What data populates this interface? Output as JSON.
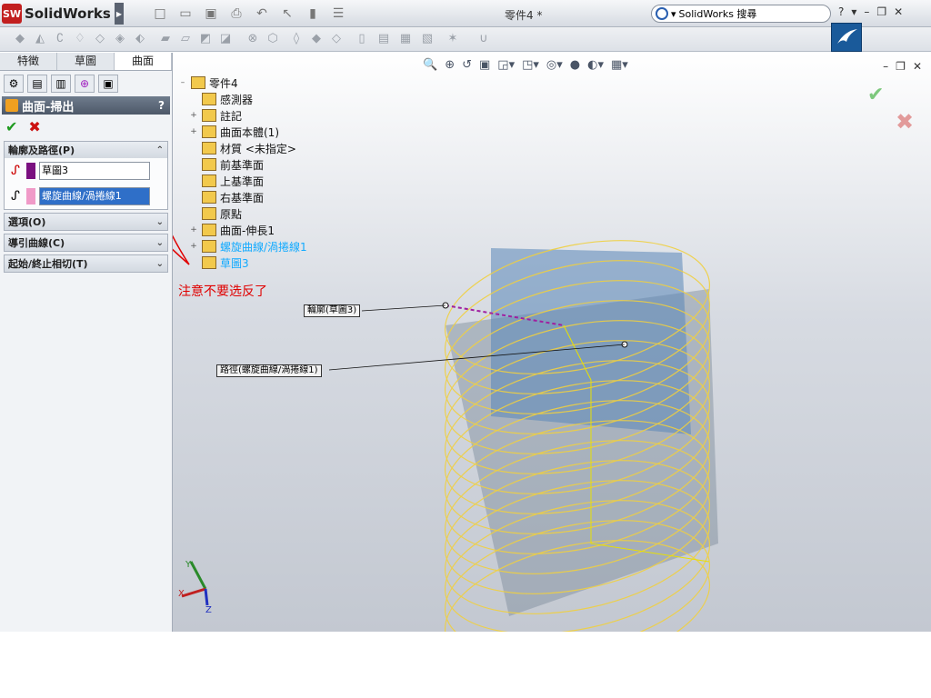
{
  "app": {
    "logo_text": "SolidWorks",
    "doc_title": "零件4 *",
    "search_placeholder": "SolidWorks 搜尋",
    "help_label": "?"
  },
  "left_panel": {
    "tabs": [
      "特徵",
      "草圖",
      "曲面"
    ],
    "active_tab": "曲面",
    "pm_title": "曲面-掃出",
    "help": "?",
    "groups": [
      {
        "title": "輪廓及路徑(P)",
        "expanded": true
      },
      {
        "title": "選項(O)",
        "expanded": false
      },
      {
        "title": "導引曲線(C)",
        "expanded": false
      },
      {
        "title": "起始/終止相切(T)",
        "expanded": false
      }
    ],
    "profile_value": "草圖3",
    "path_value": "螺旋曲線/渦捲線1"
  },
  "tree": {
    "root": "零件4",
    "items": [
      {
        "label": "感測器",
        "expandable": false
      },
      {
        "label": "註記",
        "expandable": true
      },
      {
        "label": "曲面本體(1)",
        "expandable": true
      },
      {
        "label": "材質 <未指定>",
        "expandable": false
      },
      {
        "label": "前基準面",
        "expandable": false
      },
      {
        "label": "上基準面",
        "expandable": false
      },
      {
        "label": "右基準面",
        "expandable": false
      },
      {
        "label": "原點",
        "expandable": false
      },
      {
        "label": "曲面-伸長1",
        "expandable": true
      },
      {
        "label": "螺旋曲線/渦捲線1",
        "expandable": true,
        "selected": true
      },
      {
        "label": "草圖3",
        "expandable": false,
        "selected": true
      }
    ]
  },
  "annotation": "注意不要选反了",
  "viewport_labels": {
    "profile": "輪廓(草圖3)",
    "path": "路徑(螺旋曲線/渦捲線1)"
  },
  "triad": {
    "x": "X",
    "y": "Y",
    "z": "Z"
  },
  "colors": {
    "annotation": "#e00000",
    "tree_selected": "#11aaff",
    "helix": "#f0d040",
    "surface": "#7a8a9a"
  }
}
